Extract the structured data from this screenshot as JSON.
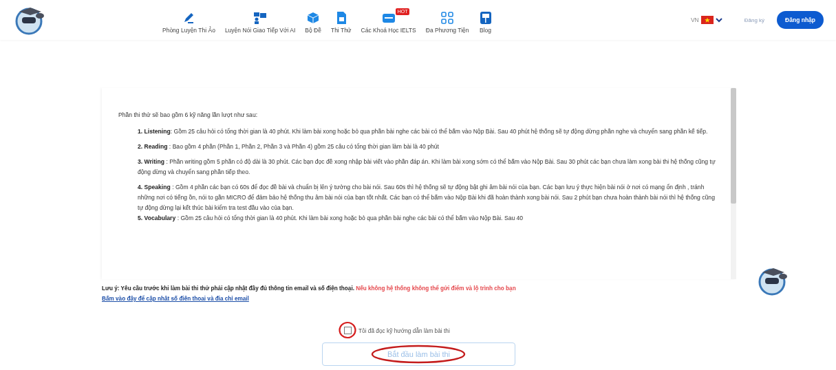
{
  "header": {
    "nav": [
      {
        "label": "Phòng Luyện Thi Ảo",
        "kind": "pen"
      },
      {
        "label": "Luyện Nói Giao Tiếp Với AI",
        "kind": "chat"
      },
      {
        "label": "Bộ Đề",
        "kind": "cube"
      },
      {
        "label": "Thi Thử",
        "kind": "doc"
      },
      {
        "label": "Các Khoá Học IELTS",
        "kind": "card",
        "badge": "HOT"
      },
      {
        "label": "Đa Phương Tiện",
        "kind": "grid"
      },
      {
        "label": "Blog",
        "kind": "book"
      }
    ],
    "language": "VN",
    "register": "Đăng ký",
    "login": "Đăng nhập"
  },
  "instructions": {
    "intro": "Phần thi thử sẽ bao gồm 6 kỹ năng lần lượt như sau:",
    "items": [
      "**1. Listening**: Gồm 25 câu hỏi có tổng thời gian là 40 phút. Khi làm bài xong hoặc bỏ qua phần bài nghe các bài có thể bấm vào Nộp Bài. Sau 40 phút hệ thống sẽ tự động dừng phần nghe và chuyển sang phần kế tiếp.",
      "**2. Reading** : Bao gồm 4 phần (Phần 1, Phần 2, Phần 3 và Phần 4) gồm 25 câu có tổng thời gian làm bài là 40 phút",
      "**3. Writing** : Phần writing gồm 5 phần có độ dài là 30 phút. Các bạn đọc đề xong nhập bài viết vào phần đáp án. Khi làm bài xong sớm có thể bấm vào Nộp Bài. Sau 30 phút các bạn chưa làm xong bài thi hệ thống cũng tự động dừng và chuyển sang phần tiếp theo.",
      "**4. Speaking** : Gồm 4 phần các bạn có 60s để đọc đề bài và chuẩn bị lên ý tưởng cho bài nói. Sau 60s thì hệ thống sẽ tự động bật ghi âm bài nói của bạn. Các bạn lưu ý thực hiện bài nói ở nơi có mạng ổn định , tránh những nơi có tiếng ồn, nói to gần MICRO để đảm bảo hệ thống thu âm bài nói của bạn tốt nhất. Các bạn có thể bấm vào Nộp Bài khi đã hoàn thành xong bài nói. Sau 2 phút bạn chưa hoàn thành bài nói thì hệ thống cũng tự động dừng lại kết thúc bài kiểm tra test đầu vào của bạn.",
      "**5. Vocabulary** : Gồm 25 câu hỏi có tổng thời gian là 40 phút. Khi làm bài xong hoặc bỏ qua phần bài nghe các bài có thể bấm vào Nộp Bài. Sau 40"
    ]
  },
  "notice": {
    "text": "Lưu ý: Yêu cầu trước khi làm bài thi thử phải cập nhật đầy đủ thông tin email và số điện thoại.",
    "warning": "Nếu không hệ thống không thể gửi điểm và lộ trình cho bạn",
    "link": "Bấm vào đây để cập nhật số điện thoại và địa chỉ email"
  },
  "agree": {
    "label": "Tôi đã đọc kỹ hướng dẫn làm bài thi",
    "checked": false
  },
  "start_button": {
    "label": "Bắt đầu làm bài thi",
    "disabled": true
  }
}
